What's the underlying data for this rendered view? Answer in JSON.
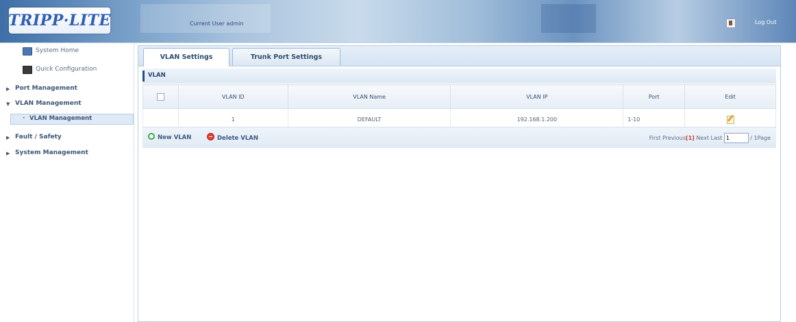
{
  "header": {
    "logo_text": "TRIPP·LITE",
    "current_user": "Current User admin",
    "logout_label": "Log Out"
  },
  "sidebar": {
    "items": [
      {
        "label": "System Home"
      },
      {
        "label": "Quick Configuration"
      },
      {
        "label": "Port Management"
      },
      {
        "label": "VLAN Management"
      },
      {
        "label": "VLAN Management"
      },
      {
        "label": "Fault / Safety"
      },
      {
        "label": "System Management"
      }
    ]
  },
  "main": {
    "tabs": [
      {
        "label": "VLAN Settings"
      },
      {
        "label": "Trunk Port Settings"
      }
    ],
    "section_title": "VLAN",
    "table": {
      "columns": [
        "VLAN ID",
        "VLAN Name",
        "VLAN IP",
        "Port",
        "Edit"
      ],
      "rows": [
        {
          "id": "1",
          "name": "DEFAULT",
          "ip": "192.168.1.200",
          "port": "1-10"
        }
      ]
    },
    "actions": {
      "new_label": "New VLAN",
      "delete_label": "Delete VLAN"
    },
    "pager": {
      "first": "First",
      "previous": "Previous",
      "current": "[1]",
      "next": "Next",
      "last": "Last",
      "page_value": "1",
      "total": "/ 1Page"
    }
  }
}
